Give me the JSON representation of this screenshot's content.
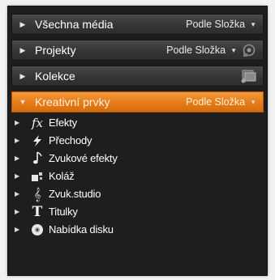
{
  "panel": {
    "headers": [
      {
        "title": "Všechna média",
        "sort": "Podle Složka"
      },
      {
        "title": "Projekty",
        "sort": "Podle Složka"
      },
      {
        "title": "Kolekce"
      },
      {
        "title": "Kreativní prvky",
        "sort": "Podle Složka"
      }
    ],
    "items": [
      {
        "label": "Efekty",
        "icon": "fx-icon"
      },
      {
        "label": "Přechody",
        "icon": "transition-bolt-icon"
      },
      {
        "label": "Zvukové efekty",
        "icon": "music-note-icon"
      },
      {
        "label": "Koláž",
        "icon": "collage-icon"
      },
      {
        "label": "Zvuk.studio",
        "icon": "sound-studio-icon"
      },
      {
        "label": "Titulky",
        "icon": "title-t-icon"
      },
      {
        "label": "Nabídka disku",
        "icon": "disc-menu-icon"
      }
    ]
  },
  "colors": {
    "active_header": "#e67b16",
    "panel_bg": "#1e1e1e"
  }
}
